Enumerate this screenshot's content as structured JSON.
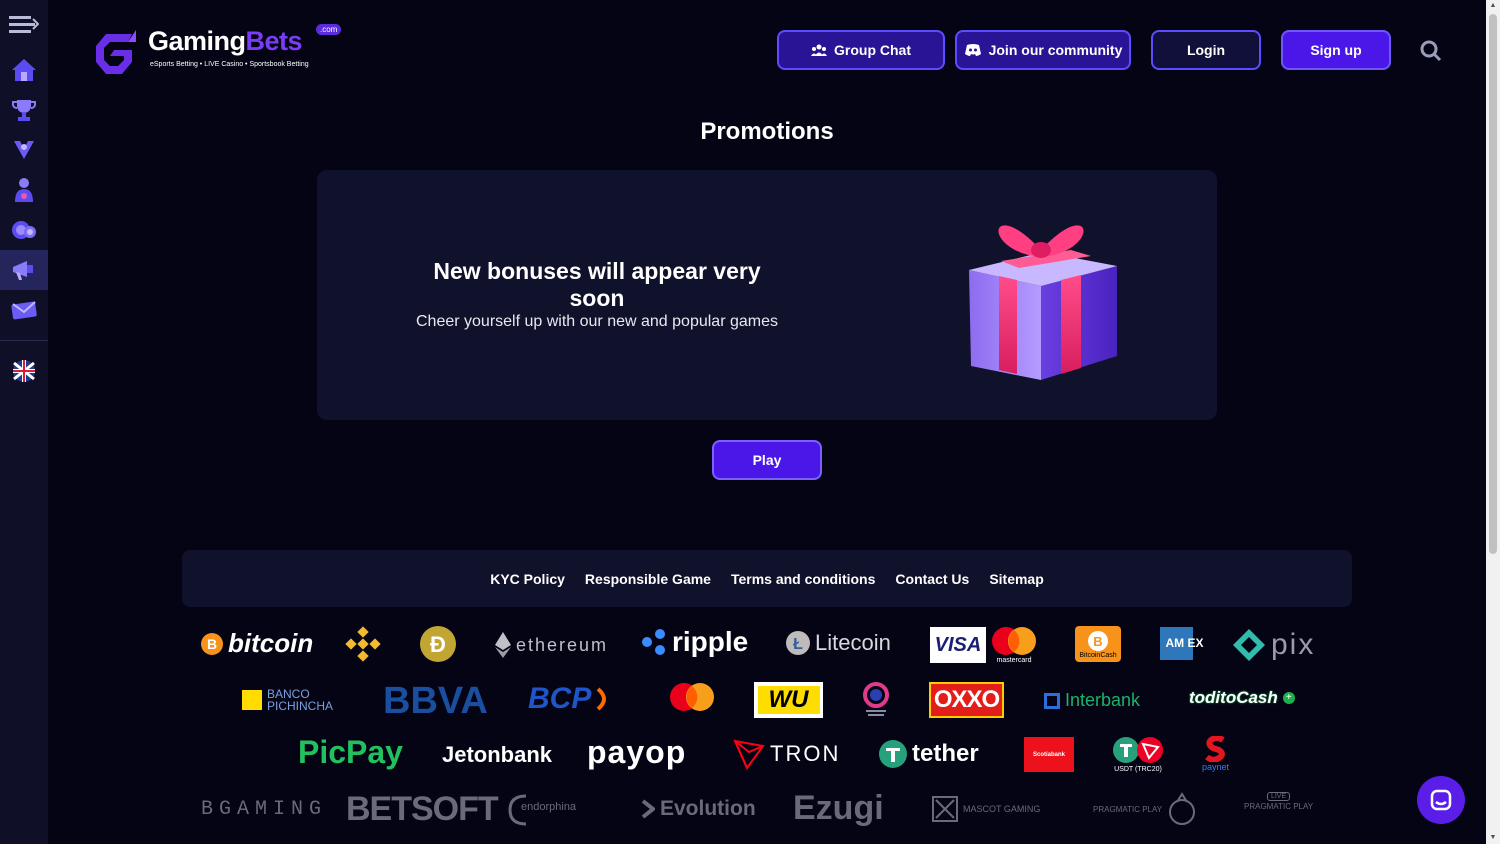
{
  "logo": {
    "name_part1": "Gaming",
    "name_part2": "Bets",
    "com": ".com",
    "tagline": "eSports Betting • LIVE Casino • Sportsbook Betting"
  },
  "header": {
    "group_chat": "Group Chat",
    "join_community": "Join our community",
    "login": "Login",
    "signup": "Sign up"
  },
  "sidebar": {
    "items": [
      "menu-toggle",
      "home",
      "trophy",
      "esports",
      "live-casino",
      "casino-chips",
      "promotions",
      "mail",
      "language-uk"
    ],
    "active": "promotions"
  },
  "main": {
    "title": "Promotions",
    "card_heading": "New bonuses will appear very soon",
    "card_sub": "Cheer yourself up with our new and popular games",
    "play": "Play"
  },
  "footer": {
    "links": [
      "KYC Policy",
      "Responsible Game",
      "Terms and conditions",
      "Contact Us",
      "Sitemap"
    ]
  },
  "payments": {
    "bitcoin": "bitcoin",
    "ethereum": "ethereum",
    "ripple": "ripple",
    "litecoin": "Litecoin",
    "visa": "VISA",
    "mastercard": "mastercard",
    "bitcoincash": "BitcoinCash",
    "amex": "AM EX",
    "pix": "pix",
    "banco_pichincha": "BANCO PICHINCHA",
    "bbva": "BBVA",
    "bcp": "BCP",
    "wu": "WU",
    "oxxo": "OXXO",
    "interbank": "Interbank",
    "todito": "toditoCash",
    "picpay": "PicPay",
    "jetonbank": "Jetonbank",
    "payop": "payop",
    "tron": "TRON",
    "tether": "tether",
    "scotiabank": "Scotiabank",
    "usdt": "USDT (TRC20)",
    "paynet": "paynet",
    "bgaming": "BGAMING",
    "betsoft": "BETSOFT",
    "endorphina": "endorphina",
    "evolution": "Evolution",
    "ezugi": "Ezugi",
    "mascot": "MASCOT GAMING",
    "pragmatic": "PRAGMATIC PLAY",
    "pragmatic_live": "PRAGMATIC PLAY",
    "live_badge": "LIVE"
  },
  "colors": {
    "accent": "#4a17e8",
    "background": "#040414",
    "card": "#10112a",
    "sidebar": "#0f1028"
  }
}
